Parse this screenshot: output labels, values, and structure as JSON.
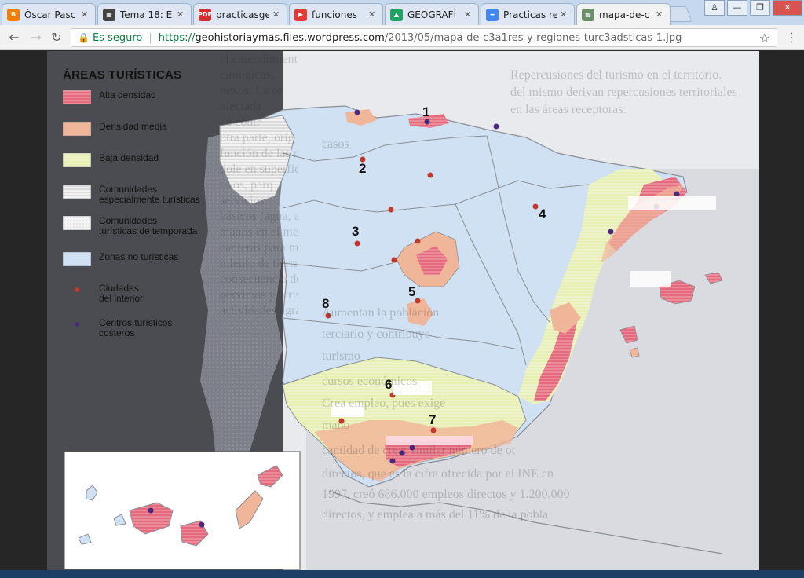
{
  "tabs": [
    {
      "label": "Óscar Pasc",
      "favicon": "blogger-icon",
      "color": "#f57d00"
    },
    {
      "label": "Tema 18: E",
      "favicon": "image-icon",
      "color": "#444"
    },
    {
      "label": "practicasge",
      "favicon": "pdf-icon",
      "color": "#d32f2f"
    },
    {
      "label": "funciones",
      "favicon": "youtube-icon",
      "color": "#e53935"
    },
    {
      "label": "GEOGRAFÍ",
      "favicon": "drive-icon",
      "color": "#1fa463"
    },
    {
      "label": "Practicas re",
      "favicon": "docs-icon",
      "color": "#4285f4"
    },
    {
      "label": "mapa-de-c",
      "favicon": "map-thumb-icon",
      "color": "#6b8e6b"
    }
  ],
  "toolbar": {
    "secure_label": "Es seguro",
    "url_scheme": "https://",
    "url_host": "geohistoriaymas.files.wordpress.com",
    "url_path": "/2013/05/mapa-de-c3a1res-y-regiones-turc3adsticas-1.jpg"
  },
  "map": {
    "legend_title": "ÁREAS TURÍSTICAS",
    "legend": [
      {
        "label": "Alta densidad",
        "color": "#e46b7e",
        "pattern": "stripes"
      },
      {
        "label": "Densidad media",
        "color": "#f0b69a",
        "pattern": "solid"
      },
      {
        "label": "Baja densidad",
        "color": "#e6efb5",
        "pattern": "stripes"
      },
      {
        "label": "Comunidades",
        "label2": "especialmente turísticas",
        "color": "#f2f2f2",
        "pattern": "hatch"
      },
      {
        "label": "Comunidades",
        "label2": "turísticas de temporada",
        "color": "#f4f4f4",
        "pattern": "dots"
      },
      {
        "label": "Zonas no turísticas",
        "color": "#cfe1f3",
        "pattern": "solid"
      },
      {
        "label": "Ciudades",
        "label2": "del interior",
        "color": "#c0392b",
        "pattern": "dot"
      },
      {
        "label": "Centros turísticos",
        "label2": "costeros",
        "color": "#4b2a7b",
        "pattern": "dot"
      }
    ],
    "region_numbers": [
      "1",
      "2",
      "3",
      "4",
      "5",
      "6",
      "7",
      "8"
    ],
    "colors": {
      "sea": "#e9eaee",
      "nontourist": "#cfe1f3",
      "high": "#e46b7e",
      "medium": "#f0b69a",
      "low": "#e6efb5",
      "border": "#8a8f96"
    }
  },
  "background_text": [
    "el entendimiento político",
    "ciológicas.",
    "nexos. La or",
    "afectada",
    "de contr",
    "otra parte, orig",
    "función de las neces",
    "dole en superficie",
    "tivos, parq",
    "servicios",
    "básicos (agua, alimentos),",
    "manos en el medio (de",
    "canteras para materiales",
    "miento de tierra para el",
    "consecuencia de estos supe",
    "gervicios y turismo",
    "actividades agrarias",
    "Repercusiones del turismo en el territorio.",
    "del mismo derivan repercusiones territoriales",
    "en las áreas receptoras:",
    "casos",
    "Aumentan la población",
    "terciario y contribuye",
    "turismo",
    "cursos económicos",
    "Crea empleo, pues exige",
    "mano",
    "cantidad de crear similar número de ot",
    "directos, que es la cifra ofrecida por el INE en",
    "1997, creó 686.000 empleos directos y 1.200.000",
    "directos, y emplea a más del 11% de la pobla"
  ]
}
